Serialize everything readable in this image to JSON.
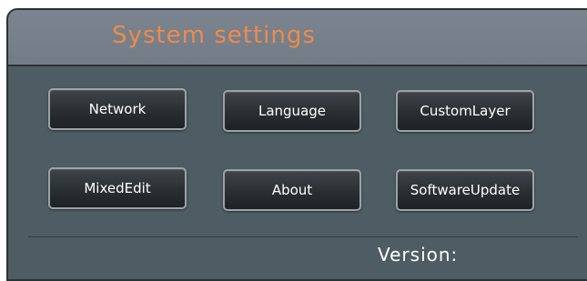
{
  "header": {
    "title": "System settings"
  },
  "buttons": {
    "network": "Network",
    "language": "Language",
    "custom_layer": "CustomLayer",
    "mixed_edit": "MixedEdit",
    "about": "About",
    "software_update": "SoftwareUpdate"
  },
  "footer": {
    "version_label": "Version:"
  },
  "colors": {
    "title_accent": "#ee8a4a",
    "panel_bg": "#4e5d63",
    "header_bg": "#7c858f",
    "button_bg": "#2a2f33"
  }
}
